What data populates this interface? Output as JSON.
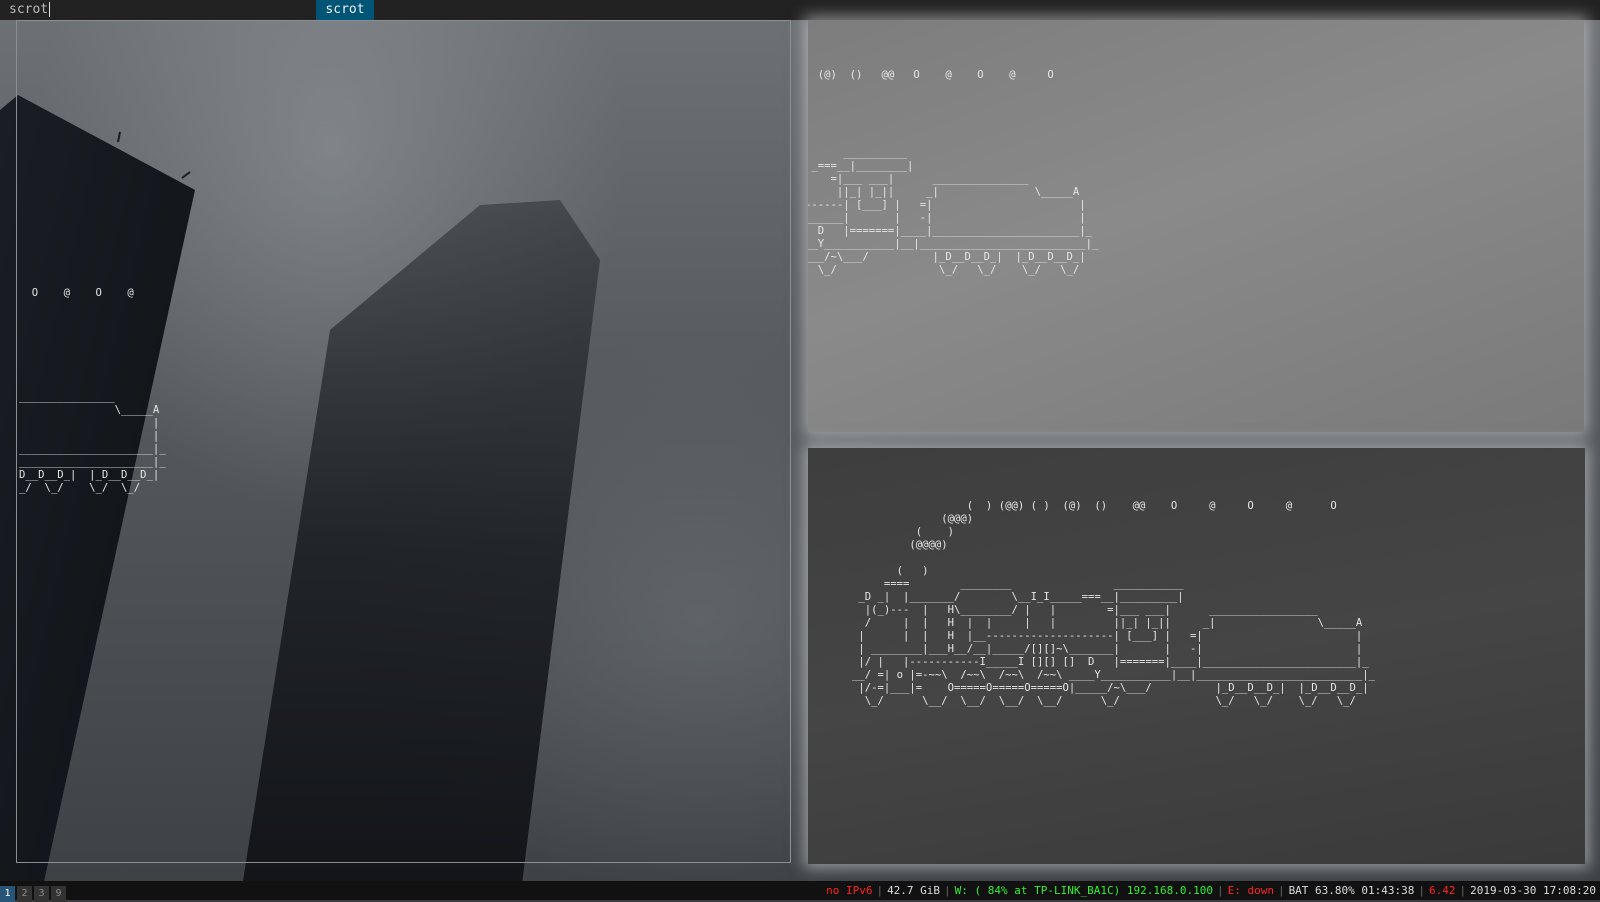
{
  "dmenu": {
    "input_text": "scrot",
    "items": [
      "scrot"
    ]
  },
  "windows": {
    "left": {
      "art": "  O    @    O    @\n\n\n\n\n\n\n\n_______________\n               \\_____A\n                     |\n                     |\n_____________________|_\n_____________________|_\nD__D__D_|  |_D__D__D_|\n_/  \\_/    \\_/  \\_/"
    },
    "top_right": {
      "art": "  (@)  ()   @@   O    @    O    @     O\n\n\n\n\n\n      __________\n _===__|________|\n    =|___ ___|      _______________\n     ||_| |_||     _|               \\_____A\n------| [___] |   =|                       |\n______|       |   -|                       |\n  D   |=======|____|_______________________|_\n__Y___________|__|__________________________|_\n___/~\\___/          |_D__D__D_|  |_D__D__D_|\n  \\_/                \\_/   \\_/    \\_/   \\_/"
    },
    "bottom_right": {
      "art": "                  (  ) (@@) ( )  (@)  ()    @@    O     @     O     @      O\n              (@@@)\n          (    )\n         (@@@@)\n\n       (   )\n     ====        ________                ___________\n _D _|  |_______/        \\__I_I_____===__|_________|\n  |(_)---  |   H\\________/ |   |        =|___ ___|      _________________\n  /     |  |   H  |  |     |   |         ||_| |_||     _|                \\_____A\n |      |  |   H  |__--------------------| [___] |   =|                        |\n | ________|___H__/__|_____/[][]~\\_______|       |   -|                        |\n |/ |   |-----------I_____I [][] []  D   |=======|____|________________________|_\n__/ =| o |=-~~\\  /~~\\  /~~\\  /~~\\ ____Y___________|__|__________________________|_\n |/-=|___|=    O=====O=====O=====O|_____/~\\___/          |_D__D__D_|  |_D__D__D_|\n  \\_/      \\__/  \\__/  \\__/  \\__/      \\_/               \\_/   \\_/    \\_/   \\_/"
    }
  },
  "statusbar": {
    "workspaces": [
      "1",
      "2",
      "3",
      "9"
    ],
    "active_workspace": "1",
    "ipv6": "no IPv6",
    "disk": "42.7 GiB",
    "wireless": "W: ( 84% at TP-LINK_BA1C) 192.168.0.100",
    "ethernet": "E: down",
    "battery": "BAT 63.80% 01:43:38",
    "load": "6.42",
    "datetime": "2019-03-30 17:08:20",
    "colors": {
      "bad": "#ff2222",
      "good": "#33ee33",
      "normal": "#dddddd",
      "active_workspace": "#285577"
    }
  }
}
